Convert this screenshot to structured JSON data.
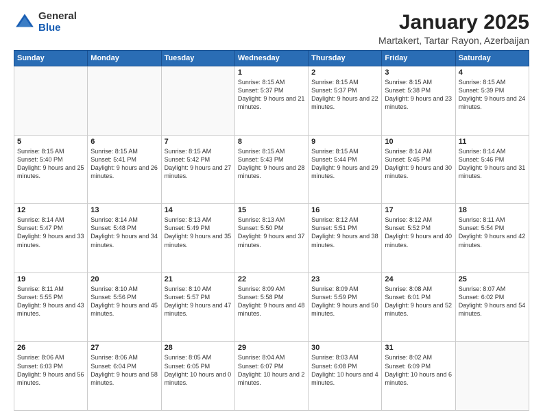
{
  "logo": {
    "general": "General",
    "blue": "Blue"
  },
  "title": "January 2025",
  "location": "Martakert, Tartar Rayon, Azerbaijan",
  "days_header": [
    "Sunday",
    "Monday",
    "Tuesday",
    "Wednesday",
    "Thursday",
    "Friday",
    "Saturday"
  ],
  "weeks": [
    [
      {
        "day": "",
        "detail": ""
      },
      {
        "day": "",
        "detail": ""
      },
      {
        "day": "",
        "detail": ""
      },
      {
        "day": "1",
        "detail": "Sunrise: 8:15 AM\nSunset: 5:37 PM\nDaylight: 9 hours and 21 minutes."
      },
      {
        "day": "2",
        "detail": "Sunrise: 8:15 AM\nSunset: 5:37 PM\nDaylight: 9 hours and 22 minutes."
      },
      {
        "day": "3",
        "detail": "Sunrise: 8:15 AM\nSunset: 5:38 PM\nDaylight: 9 hours and 23 minutes."
      },
      {
        "day": "4",
        "detail": "Sunrise: 8:15 AM\nSunset: 5:39 PM\nDaylight: 9 hours and 24 minutes."
      }
    ],
    [
      {
        "day": "5",
        "detail": "Sunrise: 8:15 AM\nSunset: 5:40 PM\nDaylight: 9 hours and 25 minutes."
      },
      {
        "day": "6",
        "detail": "Sunrise: 8:15 AM\nSunset: 5:41 PM\nDaylight: 9 hours and 26 minutes."
      },
      {
        "day": "7",
        "detail": "Sunrise: 8:15 AM\nSunset: 5:42 PM\nDaylight: 9 hours and 27 minutes."
      },
      {
        "day": "8",
        "detail": "Sunrise: 8:15 AM\nSunset: 5:43 PM\nDaylight: 9 hours and 28 minutes."
      },
      {
        "day": "9",
        "detail": "Sunrise: 8:15 AM\nSunset: 5:44 PM\nDaylight: 9 hours and 29 minutes."
      },
      {
        "day": "10",
        "detail": "Sunrise: 8:14 AM\nSunset: 5:45 PM\nDaylight: 9 hours and 30 minutes."
      },
      {
        "day": "11",
        "detail": "Sunrise: 8:14 AM\nSunset: 5:46 PM\nDaylight: 9 hours and 31 minutes."
      }
    ],
    [
      {
        "day": "12",
        "detail": "Sunrise: 8:14 AM\nSunset: 5:47 PM\nDaylight: 9 hours and 33 minutes."
      },
      {
        "day": "13",
        "detail": "Sunrise: 8:14 AM\nSunset: 5:48 PM\nDaylight: 9 hours and 34 minutes."
      },
      {
        "day": "14",
        "detail": "Sunrise: 8:13 AM\nSunset: 5:49 PM\nDaylight: 9 hours and 35 minutes."
      },
      {
        "day": "15",
        "detail": "Sunrise: 8:13 AM\nSunset: 5:50 PM\nDaylight: 9 hours and 37 minutes."
      },
      {
        "day": "16",
        "detail": "Sunrise: 8:12 AM\nSunset: 5:51 PM\nDaylight: 9 hours and 38 minutes."
      },
      {
        "day": "17",
        "detail": "Sunrise: 8:12 AM\nSunset: 5:52 PM\nDaylight: 9 hours and 40 minutes."
      },
      {
        "day": "18",
        "detail": "Sunrise: 8:11 AM\nSunset: 5:54 PM\nDaylight: 9 hours and 42 minutes."
      }
    ],
    [
      {
        "day": "19",
        "detail": "Sunrise: 8:11 AM\nSunset: 5:55 PM\nDaylight: 9 hours and 43 minutes."
      },
      {
        "day": "20",
        "detail": "Sunrise: 8:10 AM\nSunset: 5:56 PM\nDaylight: 9 hours and 45 minutes."
      },
      {
        "day": "21",
        "detail": "Sunrise: 8:10 AM\nSunset: 5:57 PM\nDaylight: 9 hours and 47 minutes."
      },
      {
        "day": "22",
        "detail": "Sunrise: 8:09 AM\nSunset: 5:58 PM\nDaylight: 9 hours and 48 minutes."
      },
      {
        "day": "23",
        "detail": "Sunrise: 8:09 AM\nSunset: 5:59 PM\nDaylight: 9 hours and 50 minutes."
      },
      {
        "day": "24",
        "detail": "Sunrise: 8:08 AM\nSunset: 6:01 PM\nDaylight: 9 hours and 52 minutes."
      },
      {
        "day": "25",
        "detail": "Sunrise: 8:07 AM\nSunset: 6:02 PM\nDaylight: 9 hours and 54 minutes."
      }
    ],
    [
      {
        "day": "26",
        "detail": "Sunrise: 8:06 AM\nSunset: 6:03 PM\nDaylight: 9 hours and 56 minutes."
      },
      {
        "day": "27",
        "detail": "Sunrise: 8:06 AM\nSunset: 6:04 PM\nDaylight: 9 hours and 58 minutes."
      },
      {
        "day": "28",
        "detail": "Sunrise: 8:05 AM\nSunset: 6:05 PM\nDaylight: 10 hours and 0 minutes."
      },
      {
        "day": "29",
        "detail": "Sunrise: 8:04 AM\nSunset: 6:07 PM\nDaylight: 10 hours and 2 minutes."
      },
      {
        "day": "30",
        "detail": "Sunrise: 8:03 AM\nSunset: 6:08 PM\nDaylight: 10 hours and 4 minutes."
      },
      {
        "day": "31",
        "detail": "Sunrise: 8:02 AM\nSunset: 6:09 PM\nDaylight: 10 hours and 6 minutes."
      },
      {
        "day": "",
        "detail": ""
      }
    ]
  ]
}
